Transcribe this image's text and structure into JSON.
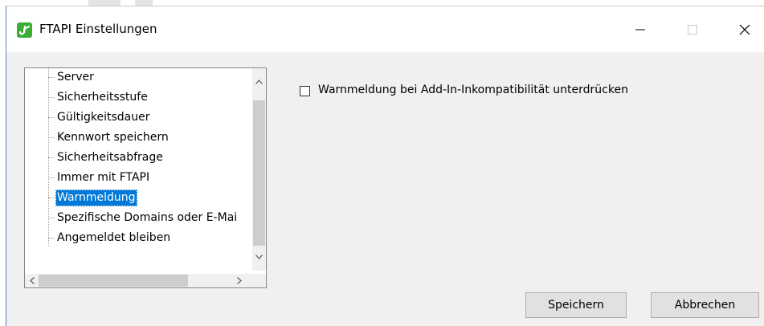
{
  "window": {
    "title": "FTAPI Einstellungen"
  },
  "title_buttons": {
    "minimize": "minimize-icon",
    "maximize": "maximize-icon",
    "close": "close-icon"
  },
  "tree": {
    "items": [
      {
        "label": "Server"
      },
      {
        "label": "Sicherheitsstufe"
      },
      {
        "label": "Gültigkeitsdauer"
      },
      {
        "label": "Kennwort speichern"
      },
      {
        "label": "Sicherheitsabfrage"
      },
      {
        "label": "Immer mit FTAPI"
      },
      {
        "label": "Warnmeldung"
      },
      {
        "label": "Spezifische Domains oder E-Mai"
      },
      {
        "label": "Angemeldet bleiben"
      }
    ],
    "selected_index": 6
  },
  "options": {
    "suppress_warning_label": "Warnmeldung bei Add-In-Inkompatibilität unterdrücken",
    "suppress_warning_checked": false
  },
  "buttons": {
    "save": "Speichern",
    "cancel": "Abbrechen"
  },
  "colors": {
    "selection": "#0078d7",
    "app_icon": "#3cad35"
  }
}
